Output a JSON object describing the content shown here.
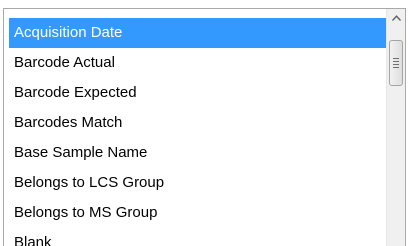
{
  "listbox": {
    "selected_index": 0,
    "items": [
      {
        "label": "Acquisition Date"
      },
      {
        "label": "Barcode Actual"
      },
      {
        "label": "Barcode Expected"
      },
      {
        "label": "Barcodes Match"
      },
      {
        "label": "Base Sample Name"
      },
      {
        "label": "Belongs to LCS Group"
      },
      {
        "label": "Belongs to MS Group"
      },
      {
        "label": "Blank"
      }
    ]
  },
  "scrollbar": {
    "up_icon": "chevron-up-icon",
    "thumb_icon": "grip-icon"
  },
  "colors": {
    "selection": "#3399ff",
    "selection_text": "#ffffff",
    "border": "#a9a9a9"
  }
}
